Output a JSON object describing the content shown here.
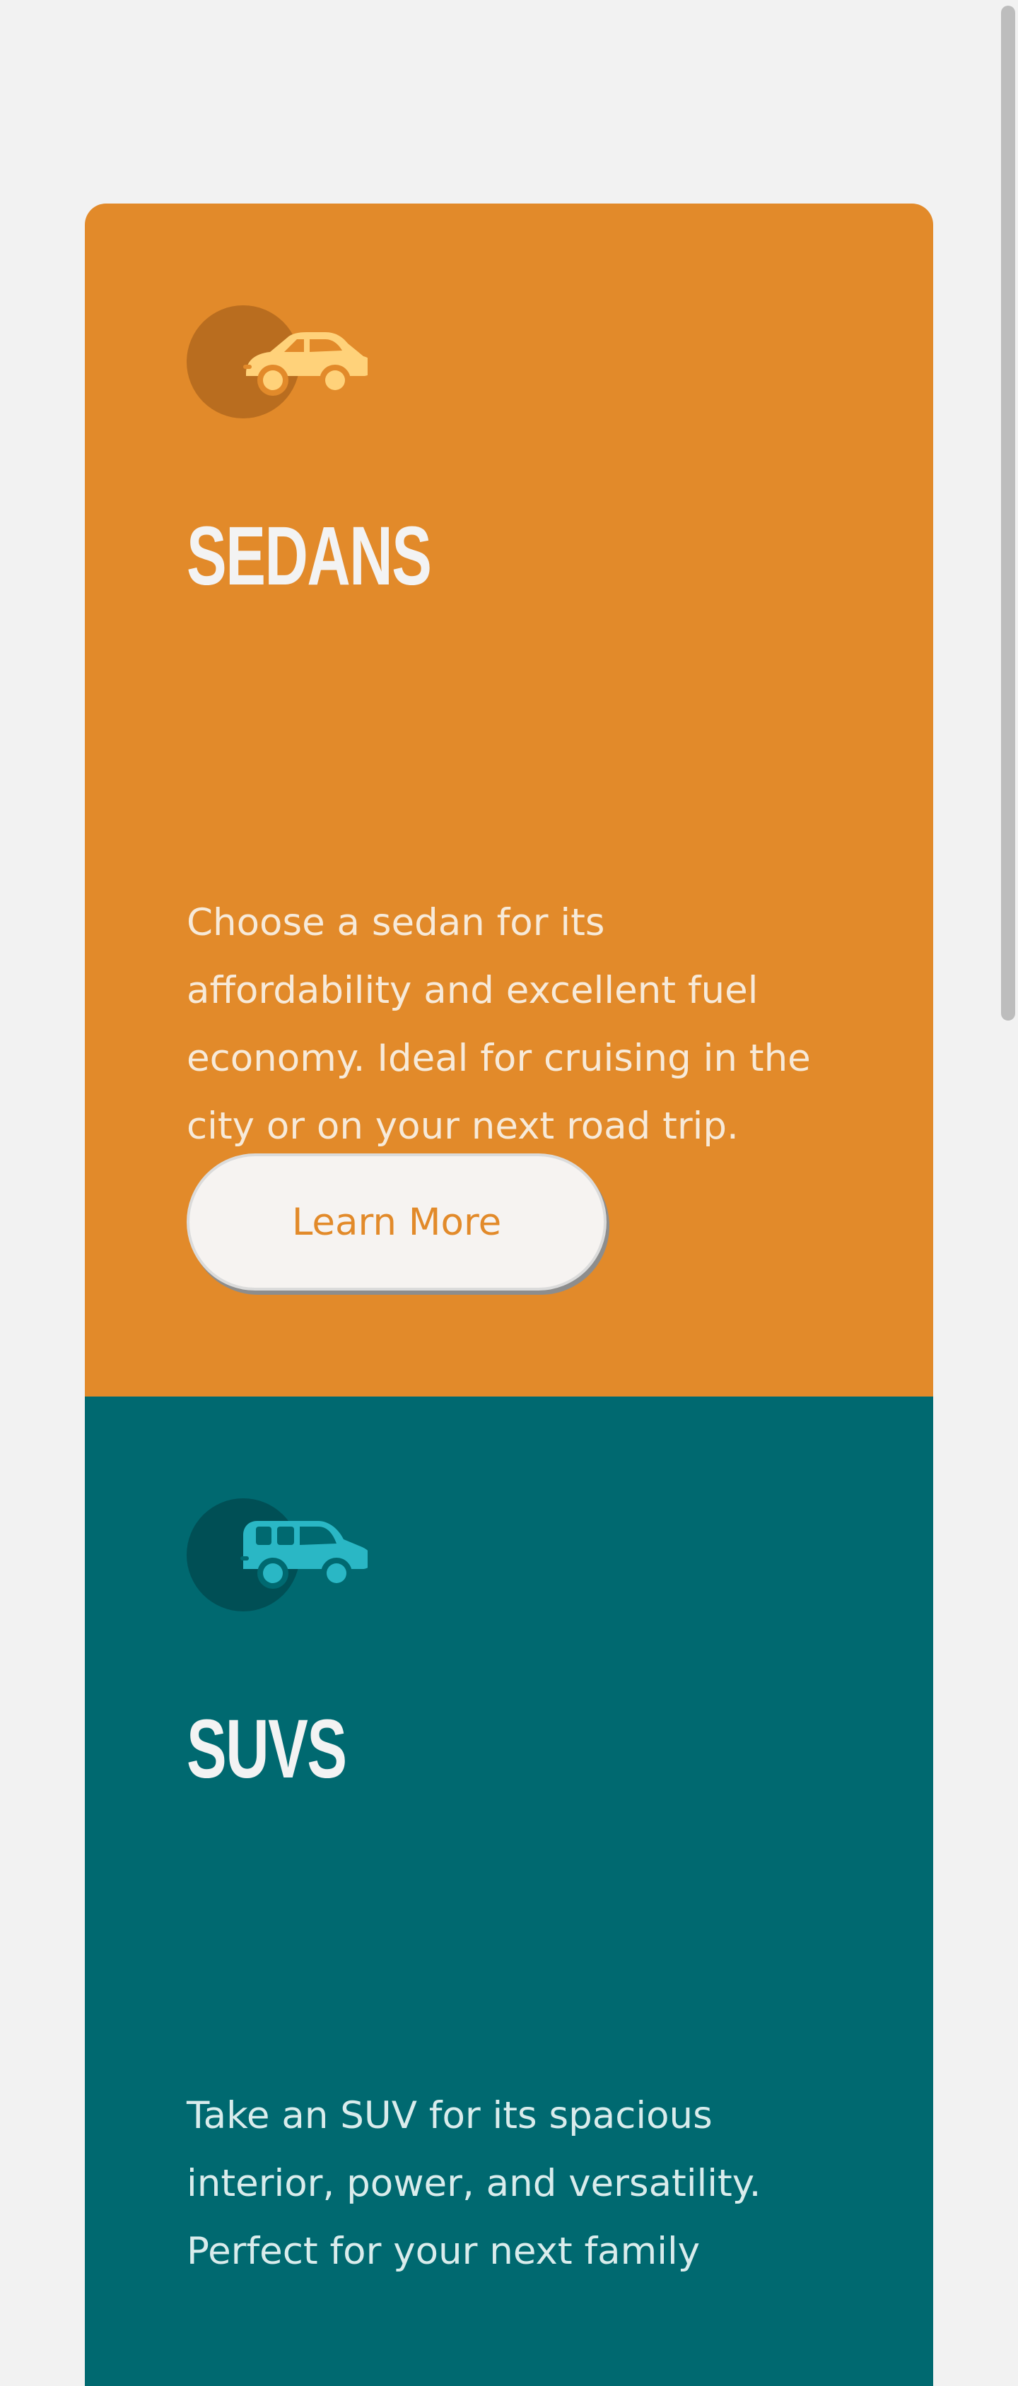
{
  "cards": [
    {
      "id": "sedans",
      "icon": "sedan-car-icon",
      "title": "SEDANS",
      "description": "Choose a sedan for its affordability and excellent fuel economy. Ideal for cruising in the city or on your next road trip.",
      "button_label": "Learn More",
      "background": "#e28a2a",
      "icon_accent": "#ffd27a",
      "icon_circle": "#b96d1f"
    },
    {
      "id": "suvs",
      "icon": "suv-car-icon",
      "title": "SUVS",
      "description": "Take an SUV for its spacious interior, power, and versatility. Perfect for your next family",
      "background": "#006970",
      "icon_accent": "#2ab7c5",
      "icon_circle": "#004f55"
    }
  ]
}
